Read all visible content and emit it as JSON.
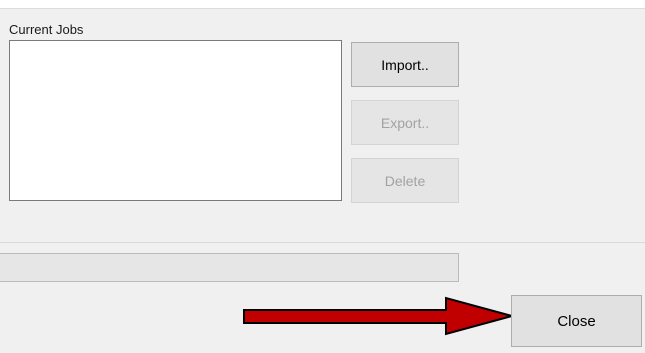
{
  "jobs_group": {
    "label": "Current Jobs",
    "items": []
  },
  "buttons": {
    "import_label": "Import..",
    "export_label": "Export..",
    "delete_label": "Delete",
    "close_label": "Close"
  },
  "progress": {
    "value": 0
  },
  "annotation": {
    "arrow_color": "#c00000",
    "arrow_points_to": "close-button"
  }
}
